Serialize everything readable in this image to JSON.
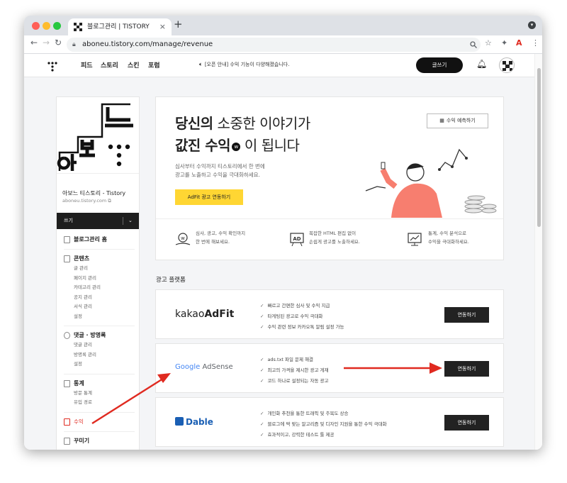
{
  "browser": {
    "tab_title": "블로그관리 | TISTORY",
    "tab_close": "×",
    "new_tab": "+",
    "url": "aboneu.tistory.com/manage/revenue",
    "back": "←",
    "forward": "→",
    "reload": "↻"
  },
  "header": {
    "nav": [
      "피드",
      "스토리",
      "스킨",
      "포럼"
    ],
    "notice": "[오픈 안내] 수익 기능이 다양해졌습니다.",
    "write_label": "글쓰기"
  },
  "sidebar": {
    "blog_name": "아보느 티스토리 - Tistory",
    "blog_url": "aboneu.tistory.com",
    "dropdown_label": "쓰기",
    "home": "블로그관리 홈",
    "groups": [
      {
        "title": "콘텐츠",
        "items": [
          "글 관리",
          "페이지 관리",
          "카테고리 관리",
          "공지 관리",
          "서식 관리",
          "설정"
        ]
      },
      {
        "title": "댓글 · 방명록",
        "items": [
          "댓글 관리",
          "방명록 관리",
          "설정"
        ]
      },
      {
        "title": "통계",
        "items": [
          "방문 통계",
          "유입 경로"
        ]
      }
    ],
    "revenue": "수익",
    "decorate": "꾸미기"
  },
  "hero": {
    "line1_bold": "당신의",
    "line1_rest": " 소중한 이야기가",
    "line2_bold": "값진 수익",
    "line2_rest": " 이 됩니다",
    "sub1": "심사부터 수익까지 티스토리에서 한 번에",
    "sub2": "광고를 노출하고 수익을 극대화하세요.",
    "adfit_button": "AdFit 광고 연동하기",
    "estimate_button": "수익 예측하기",
    "features": [
      {
        "l1": "심사, 광고, 수익 확인까지",
        "l2": "한 번에 해보세요."
      },
      {
        "l1": "복잡한 HTML 편집 없이",
        "l2": "손쉽게 광고를 노출하세요."
      },
      {
        "l1": "통계, 수익 분석으로",
        "l2": "수익을 극대화하세요."
      }
    ]
  },
  "platforms": {
    "section_title": "광고 플랫폼",
    "items": [
      {
        "brand_a": "kakao",
        "brand_b": "AdFit",
        "bullets": [
          "빠르고 간편한 심사 및 수익 지급",
          "타게팅된 광고로 수익 극대화",
          "수익 관련 정보 카카오톡 알림 설정 가능"
        ],
        "button": "연동하기"
      },
      {
        "brand_a": "Google",
        "brand_b": "AdSense",
        "bullets": [
          "ads.txt 파일 문제 해결",
          "최고의 가격을 제시한 광고 게재",
          "코드 하나로 설정되는 자동 광고"
        ],
        "button": "연동하기"
      },
      {
        "brand_a": "",
        "brand_b": "Dable",
        "bullets": [
          "개인화 추천을 통한 트래픽 및 주목도 상승",
          "블로그에 딱 맞는 알고리즘 및 디자인 지원을 통한 수익 극대화",
          "효과적이고, 강력한 테스트 툴 제공"
        ],
        "button": "연동하기"
      }
    ]
  },
  "colors": {
    "accent_red": "#e02a20",
    "adfit_yellow": "#ffd633",
    "button_dark": "#222222"
  },
  "icons": [
    "lock-icon",
    "bell-icon",
    "search-icon",
    "star-icon",
    "extension-icon",
    "check-icon"
  ]
}
